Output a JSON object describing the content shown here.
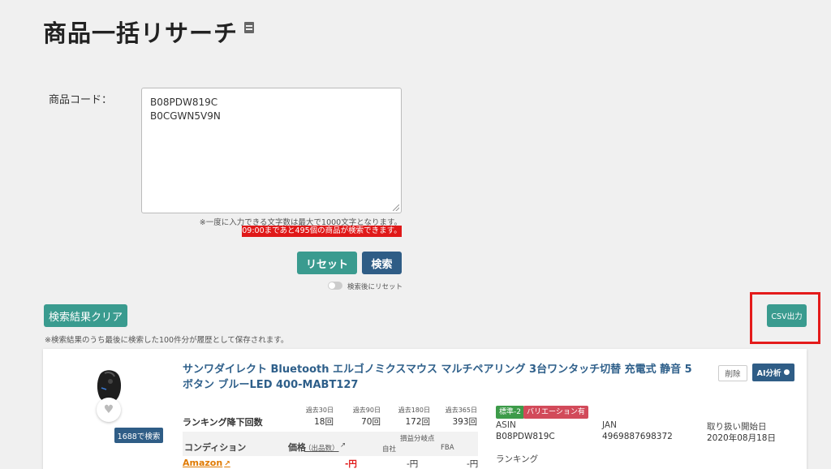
{
  "page": {
    "title": "商品一括リサーチ"
  },
  "form": {
    "code_label": "商品コード：",
    "codes": [
      "B08PDW819C",
      "B0CGWN5V9N"
    ],
    "limit_note": "※一度に入力できる文字数は最大で1000文字となります。",
    "remaining_alert": "09:00まであと495個の商品が検索できます。",
    "reset_label": "リセット",
    "search_label": "検索",
    "toggle_label": "検索後にリセット"
  },
  "results": {
    "clear_label": "検索結果クリア",
    "history_note": "※検索結果のうち最後に検索した100件分が履歴として保存されます。",
    "csv_label": "CSV出力"
  },
  "product": {
    "title": "サンワダイレクト Bluetooth エルゴノミクスマウス マルチペアリング 3台ワンタッチ切替 充電式 静音 5ボタン ブルーLED 400-MABT127",
    "search_1688_label": "1688で検索",
    "delete_label": "削除",
    "ai_label": "AI分析",
    "ranking": {
      "label": "ランキング降下回数",
      "periods": [
        "過去30日",
        "過去90日",
        "過去180日",
        "過去365日"
      ],
      "values": [
        "18回",
        "70回",
        "172回",
        "393回"
      ]
    },
    "table": {
      "condition_header": "コンディション",
      "price_header": "価格",
      "price_sub": "（出品数）",
      "breakeven_header": "損益分岐点",
      "self_header": "自社",
      "fba_header": "FBA",
      "row_label": "Amazon",
      "row_price": "-円",
      "row_self": "-円",
      "row_fba": "-円"
    },
    "tags": [
      "標準-2",
      "バリエーション有"
    ],
    "info": {
      "asin_label": "ASIN",
      "asin": "B08PDW819C",
      "jan_label": "JAN",
      "jan": "4969887698372",
      "start_label": "取り扱い開始日",
      "start": "2020年08月18日",
      "ranking_label": "ランキング"
    }
  },
  "colors": {
    "teal": "#3a9b8f",
    "navy": "#2f5d86",
    "alert_red": "#e01919",
    "link_blue": "#2e5f8a",
    "amazon_orange": "#e07a00"
  }
}
